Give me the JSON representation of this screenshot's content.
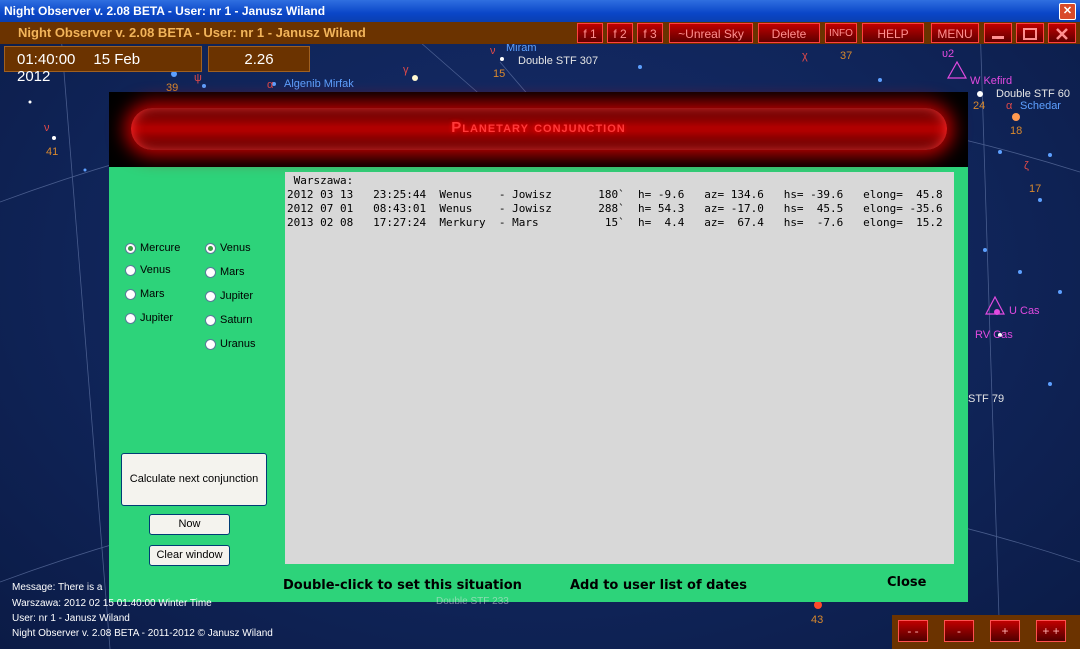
{
  "window": {
    "title": "Night Observer v. 2.08 BETA -  User:  nr 1 - Janusz Wiland",
    "close_glyph": "✕"
  },
  "header": {
    "title": "Night Observer v. 2.08 BETA -  User:  nr 1 - Janusz Wiland",
    "time": "01:40:00",
    "date": "15 Feb 2012",
    "value": "2.26"
  },
  "toolbar": {
    "f1": "f 1",
    "f2": "f 2",
    "f3": "f 3",
    "unreal": "~Unreal Sky",
    "delete": "Delete",
    "info": "INFO",
    "help": "HELP",
    "menu": "MENU"
  },
  "sky": {
    "labels": {
      "miram": "Miram",
      "stf307": "Double STF 307",
      "n15": "15",
      "n39": "39",
      "alpha": "α",
      "mirfak": "Algenib Mirfak",
      "gamma": "γ",
      "nu": "ν",
      "n41": "41",
      "chi": "χ",
      "n37": "37",
      "upsilon2": "υ2",
      "wkefird": "W Kefird",
      "stf60": "Double STF  60",
      "n24": "24",
      "alpha2": "α",
      "schedar": "Schedar",
      "n18": "18",
      "zeta": "ζ",
      "n17": "17",
      "ucas": "U Cas",
      "rvcas": "RV Cas",
      "stf79": "STF  79",
      "n43": "43",
      "psi": "ψ",
      "psi2": "ψ"
    }
  },
  "dialog": {
    "title": "Planetary conjunction",
    "output_lines": [
      " Warszawa:",
      "2012 03 13   23:25:44  Wenus    - Jowisz       180`  h= -9.6   az= 134.6   hs= -39.6   elong=  45.8",
      "2012 07 01   08:43:01  Wenus    - Jowisz       288`  h= 54.3   az= -17.0   hs=  45.5   elong= -35.6",
      "2013 02 08   17:27:24  Merkury  - Mars          15`  h=  4.4   az=  67.4   hs=  -7.6   elong=  15.2"
    ],
    "left_planets": [
      {
        "label": "Mercure",
        "checked": true
      },
      {
        "label": "Venus",
        "checked": false
      },
      {
        "label": "Mars",
        "checked": false
      },
      {
        "label": "Jupiter",
        "checked": false
      }
    ],
    "right_planets": [
      {
        "label": "Venus",
        "checked": true
      },
      {
        "label": "Mars",
        "checked": false
      },
      {
        "label": "Jupiter",
        "checked": false
      },
      {
        "label": "Saturn",
        "checked": false
      },
      {
        "label": "Uranus",
        "checked": false
      }
    ],
    "calc_button": "Calculate next conjunction",
    "now_button": "Now",
    "clear_button": "Clear window",
    "double_click": "Double-click to set this situation",
    "add_user": "Add to user list of dates",
    "close": "Close"
  },
  "status": {
    "message": "Message: There is a",
    "location": "Warszawa:  2012 02 15  01:40:00 Winter Time",
    "user": "User:  nr 1 - Janusz Wiland",
    "copyright": "Night Observer v. 2.08 BETA - 2011-2012 © Janusz Wiland",
    "behind": "Double STF 233"
  },
  "nav": {
    "minusminus": "- -",
    "minus": "-",
    "plus": "+",
    "plusplus": "+ +"
  }
}
